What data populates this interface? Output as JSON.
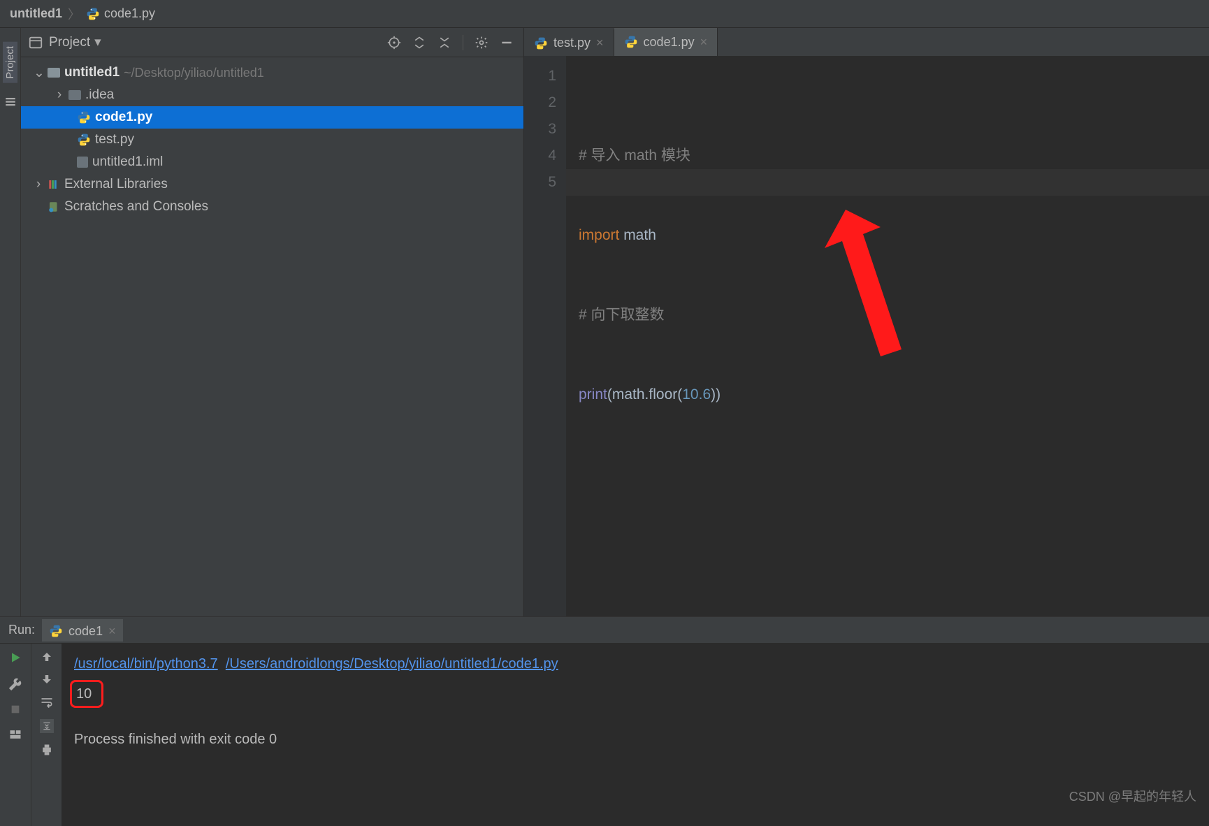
{
  "breadcrumb": {
    "root": "untitled1",
    "file": "code1.py"
  },
  "leftstrip": {
    "project_label": "Project"
  },
  "project_panel": {
    "title": "Project",
    "root_name": "untitled1",
    "root_path": "~/Desktop/yiliao/untitled1",
    "items": {
      "idea": ".idea",
      "code1": "code1.py",
      "test": "test.py",
      "iml": "untitled1.iml"
    },
    "external": "External Libraries",
    "scratches": "Scratches and Consoles"
  },
  "tabs": [
    {
      "label": "test.py"
    },
    {
      "label": "code1.py"
    }
  ],
  "code": {
    "l1_comment": "# 导入 math 模块",
    "l2_import": "import",
    "l2_math": " math",
    "l3_comment": "# 向下取整数",
    "l4_print": "print",
    "l4_math": "math",
    "l4_floor": "floor",
    "l4_num": "10.6",
    "line_numbers": [
      "1",
      "2",
      "3",
      "4",
      "5"
    ]
  },
  "run": {
    "title": "Run:",
    "tab_label": "code1",
    "cmd_python": "/usr/local/bin/python3.7",
    "cmd_script": "/Users/androidlongs/Desktop/yiliao/untitled1/code1.py",
    "output": "10",
    "exit_line": "Process finished with exit code 0"
  },
  "watermark": "CSDN @早起的年轻人"
}
